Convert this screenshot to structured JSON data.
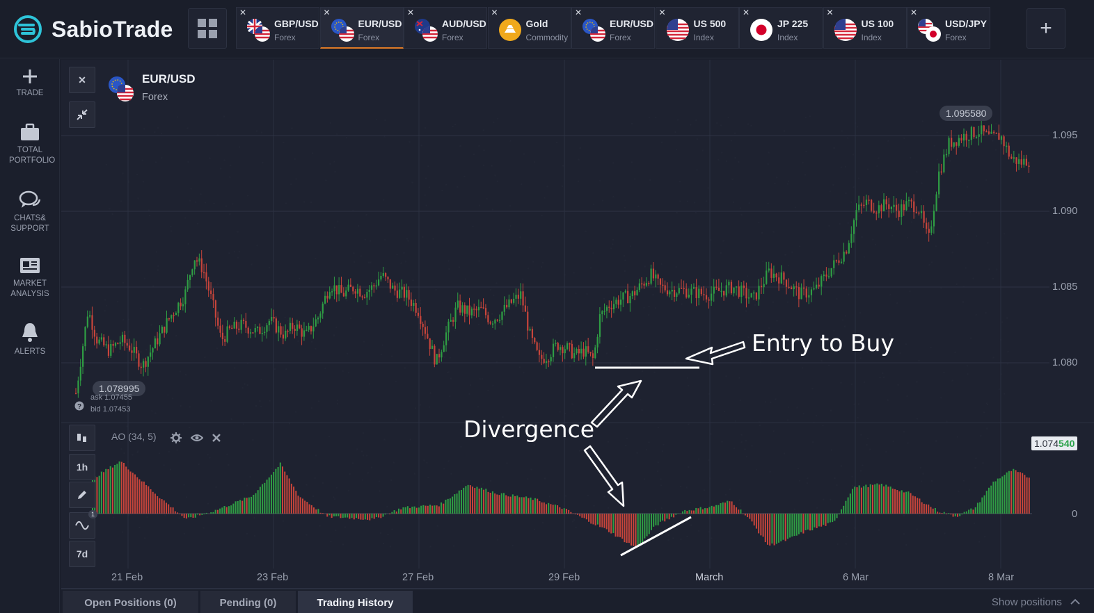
{
  "brand": {
    "name": "SabioTrade"
  },
  "tabs": [
    {
      "name": "GBP/USD",
      "sub": "Forex",
      "flag": "gbp-usd-flag",
      "active": false
    },
    {
      "name": "EUR/USD",
      "sub": "Forex",
      "flag": "eur-usd-flag",
      "active": true
    },
    {
      "name": "AUD/USD",
      "sub": "Forex",
      "flag": "aud-usd-flag",
      "active": false
    },
    {
      "name": "Gold",
      "sub": "Commodity",
      "flag": "gold-icon",
      "active": false
    },
    {
      "name": "EUR/USD",
      "sub": "Forex",
      "flag": "eur-usd-flag",
      "active": false
    },
    {
      "name": "US 500",
      "sub": "Index",
      "flag": "us-flag",
      "active": false
    },
    {
      "name": "JP 225",
      "sub": "Index",
      "flag": "jp-flag",
      "active": false
    },
    {
      "name": "US 100",
      "sub": "Index",
      "flag": "us-flag",
      "active": false
    },
    {
      "name": "USD/JPY",
      "sub": "Forex",
      "flag": "usd-jpy-flag",
      "active": false
    }
  ],
  "sidebar": {
    "items": [
      {
        "label": "TRADE",
        "icon": "plus-icon"
      },
      {
        "label": "TOTAL PORTFOLIO",
        "icon": "briefcase-icon"
      },
      {
        "label": "CHATS& SUPPORT",
        "icon": "chat-icon"
      },
      {
        "label": "MARKET ANALYSIS",
        "icon": "newspaper-icon"
      },
      {
        "label": "ALERTS",
        "icon": "bell-icon"
      }
    ]
  },
  "chart": {
    "symbol": "EUR/USD",
    "category": "Forex",
    "high_label": "1.095580",
    "low_label": "1.078995",
    "ask": "ask 1.07455",
    "bid": "bid 1.07453",
    "indicator": "AO (34, 5)",
    "current_price_prefix": "1.074",
    "current_price_suffix": "540",
    "timeframe": "1h",
    "range": "7d",
    "badge_count": "1",
    "price_axis": [
      "1.095",
      "1.090",
      "1.085",
      "1.080"
    ],
    "ao_axis": "0",
    "dates": [
      "21 Feb",
      "23 Feb",
      "27 Feb",
      "29 Feb",
      "March",
      "6 Mar",
      "8 Mar"
    ]
  },
  "annotations": {
    "entry": "Entry to Buy",
    "divergence": "Divergence"
  },
  "bottom_tabs": [
    "Open Positions (0)",
    "Pending (0)",
    "Trading History"
  ],
  "show_positions": "Show positions",
  "colors": {
    "up": "#2f9e44",
    "down": "#c8453b",
    "accent": "#e07b27",
    "brand": "#2ec4d9"
  },
  "chart_data": {
    "type": "candlestick",
    "symbol": "EUR/USD",
    "x_range": [
      "21 Feb",
      "8 Mar"
    ],
    "ylim": [
      1.0755,
      1.0965
    ],
    "price_path": [
      [
        0,
        1.078
      ],
      [
        0.02,
        1.0835
      ],
      [
        0.035,
        1.0815
      ],
      [
        0.055,
        1.0808
      ],
      [
        0.075,
        1.0815
      ],
      [
        0.09,
        1.081
      ],
      [
        0.11,
        1.0798
      ],
      [
        0.13,
        1.0812
      ],
      [
        0.155,
        1.083
      ],
      [
        0.18,
        1.0845
      ],
      [
        0.195,
        1.087
      ],
      [
        0.21,
        1.0862
      ],
      [
        0.225,
        1.084
      ],
      [
        0.24,
        1.0815
      ],
      [
        0.255,
        1.0822
      ],
      [
        0.275,
        1.0825
      ],
      [
        0.3,
        1.082
      ],
      [
        0.32,
        1.0828
      ],
      [
        0.345,
        1.0818
      ],
      [
        0.36,
        1.0825
      ],
      [
        0.38,
        1.0818
      ],
      [
        0.4,
        1.083
      ],
      [
        0.42,
        1.0852
      ],
      [
        0.44,
        1.0845
      ],
      [
        0.46,
        1.085
      ],
      [
        0.475,
        1.0846
      ],
      [
        0.49,
        1.085
      ],
      [
        0.505,
        1.0858
      ],
      [
        0.525,
        1.0848
      ],
      [
        0.545,
        1.0845
      ],
      [
        0.565,
        1.0835
      ],
      [
        0.58,
        1.0818
      ],
      [
        0.595,
        1.08
      ],
      [
        0.61,
        1.0818
      ],
      [
        0.63,
        1.0837
      ],
      [
        0.65,
        1.0833
      ],
      [
        0.67,
        1.0835
      ],
      [
        0.685,
        1.0828
      ],
      [
        0.7,
        1.0832
      ],
      [
        0.72,
        1.084
      ],
      [
        0.735,
        1.0845
      ],
      [
        0.75,
        1.0818
      ],
      [
        0.765,
        1.0802
      ],
      [
        0.78,
        1.0805
      ],
      [
        0.795,
        1.0812
      ],
      [
        0.81,
        1.081
      ],
      [
        0.825,
        1.0805
      ],
      [
        0.84,
        1.0808
      ],
      [
        0.855,
        1.0802
      ],
      [
        0.865,
        1.083
      ],
      [
        0.88,
        1.0838
      ],
      [
        0.9,
        1.0842
      ],
      [
        0.92,
        1.0845
      ],
      [
        0.935,
        1.0852
      ],
      [
        0.95,
        1.0858
      ],
      [
        0.965,
        1.085
      ],
      [
        0.985,
        1.0848
      ]
    ],
    "price_path_2": [
      [
        0,
        1.0848
      ],
      [
        0.05,
        1.0845
      ],
      [
        0.1,
        1.085
      ],
      [
        0.14,
        1.0842
      ],
      [
        0.17,
        1.086
      ],
      [
        0.2,
        1.0855
      ],
      [
        0.23,
        1.0845
      ],
      [
        0.26,
        1.0848
      ],
      [
        0.29,
        1.0862
      ],
      [
        0.32,
        1.0875
      ],
      [
        0.34,
        1.09
      ],
      [
        0.36,
        1.0906
      ],
      [
        0.38,
        1.0902
      ],
      [
        0.4,
        1.0905
      ],
      [
        0.42,
        1.09
      ],
      [
        0.44,
        1.0905
      ],
      [
        0.46,
        1.0903
      ],
      [
        0.48,
        1.088
      ],
      [
        0.5,
        1.0925
      ],
      [
        0.52,
        1.0945
      ],
      [
        0.55,
        1.095
      ],
      [
        0.58,
        1.0953
      ],
      [
        0.6,
        1.0948
      ],
      [
        0.62,
        1.095
      ],
      [
        0.64,
        1.0935
      ],
      [
        0.66,
        1.0932
      ],
      [
        0.68,
        1.0935
      ]
    ],
    "ao_bars_note": "AO histogram oscillating around 0; negative trough near 29 Feb rising to 1 Mar (bullish divergence)"
  }
}
